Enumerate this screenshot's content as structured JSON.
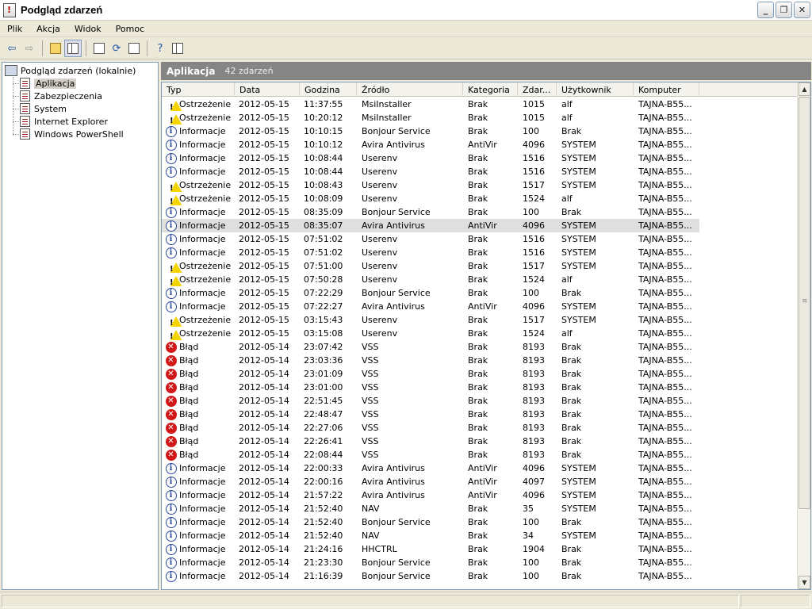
{
  "window": {
    "title": "Podgląd zdarzeń"
  },
  "menubar": [
    "Plik",
    "Akcja",
    "Widok",
    "Pomoc"
  ],
  "tree": {
    "root": "Podgląd zdarzeń (lokalnie)",
    "items": [
      {
        "label": "Aplikacja",
        "selected": true
      },
      {
        "label": "Zabezpieczenia",
        "selected": false
      },
      {
        "label": "System",
        "selected": false
      },
      {
        "label": "Internet Explorer",
        "selected": false
      },
      {
        "label": "Windows PowerShell",
        "selected": false
      }
    ]
  },
  "panel": {
    "title": "Aplikacja",
    "count": "42 zdarzeń"
  },
  "columns": [
    "Typ",
    "Data",
    "Godzina",
    "Źródło",
    "Kategoria",
    "Zdar...",
    "Użytkownik",
    "Komputer"
  ],
  "rows": [
    {
      "type": "warn",
      "t": "Ostrzeżenie",
      "d": "2012-05-15",
      "h": "11:37:55",
      "s": "MsiInstaller",
      "c": "Brak",
      "e": "1015",
      "u": "alf",
      "k": "TAJNA-B55..."
    },
    {
      "type": "warn",
      "t": "Ostrzeżenie",
      "d": "2012-05-15",
      "h": "10:20:12",
      "s": "MsiInstaller",
      "c": "Brak",
      "e": "1015",
      "u": "alf",
      "k": "TAJNA-B55..."
    },
    {
      "type": "info",
      "t": "Informacje",
      "d": "2012-05-15",
      "h": "10:10:15",
      "s": "Bonjour Service",
      "c": "Brak",
      "e": "100",
      "u": "Brak",
      "k": "TAJNA-B55..."
    },
    {
      "type": "info",
      "t": "Informacje",
      "d": "2012-05-15",
      "h": "10:10:12",
      "s": "Avira Antivirus",
      "c": "AntiVir",
      "e": "4096",
      "u": "SYSTEM",
      "k": "TAJNA-B55..."
    },
    {
      "type": "info",
      "t": "Informacje",
      "d": "2012-05-15",
      "h": "10:08:44",
      "s": "Userenv",
      "c": "Brak",
      "e": "1516",
      "u": "SYSTEM",
      "k": "TAJNA-B55..."
    },
    {
      "type": "info",
      "t": "Informacje",
      "d": "2012-05-15",
      "h": "10:08:44",
      "s": "Userenv",
      "c": "Brak",
      "e": "1516",
      "u": "SYSTEM",
      "k": "TAJNA-B55..."
    },
    {
      "type": "warn",
      "t": "Ostrzeżenie",
      "d": "2012-05-15",
      "h": "10:08:43",
      "s": "Userenv",
      "c": "Brak",
      "e": "1517",
      "u": "SYSTEM",
      "k": "TAJNA-B55..."
    },
    {
      "type": "warn",
      "t": "Ostrzeżenie",
      "d": "2012-05-15",
      "h": "10:08:09",
      "s": "Userenv",
      "c": "Brak",
      "e": "1524",
      "u": "alf",
      "k": "TAJNA-B55..."
    },
    {
      "type": "info",
      "t": "Informacje",
      "d": "2012-05-15",
      "h": "08:35:09",
      "s": "Bonjour Service",
      "c": "Brak",
      "e": "100",
      "u": "Brak",
      "k": "TAJNA-B55..."
    },
    {
      "type": "info",
      "t": "Informacje",
      "d": "2012-05-15",
      "h": "08:35:07",
      "s": "Avira Antivirus",
      "c": "AntiVir",
      "e": "4096",
      "u": "SYSTEM",
      "k": "TAJNA-B55...",
      "selected": true
    },
    {
      "type": "info",
      "t": "Informacje",
      "d": "2012-05-15",
      "h": "07:51:02",
      "s": "Userenv",
      "c": "Brak",
      "e": "1516",
      "u": "SYSTEM",
      "k": "TAJNA-B55..."
    },
    {
      "type": "info",
      "t": "Informacje",
      "d": "2012-05-15",
      "h": "07:51:02",
      "s": "Userenv",
      "c": "Brak",
      "e": "1516",
      "u": "SYSTEM",
      "k": "TAJNA-B55..."
    },
    {
      "type": "warn",
      "t": "Ostrzeżenie",
      "d": "2012-05-15",
      "h": "07:51:00",
      "s": "Userenv",
      "c": "Brak",
      "e": "1517",
      "u": "SYSTEM",
      "k": "TAJNA-B55..."
    },
    {
      "type": "warn",
      "t": "Ostrzeżenie",
      "d": "2012-05-15",
      "h": "07:50:28",
      "s": "Userenv",
      "c": "Brak",
      "e": "1524",
      "u": "alf",
      "k": "TAJNA-B55..."
    },
    {
      "type": "info",
      "t": "Informacje",
      "d": "2012-05-15",
      "h": "07:22:29",
      "s": "Bonjour Service",
      "c": "Brak",
      "e": "100",
      "u": "Brak",
      "k": "TAJNA-B55..."
    },
    {
      "type": "info",
      "t": "Informacje",
      "d": "2012-05-15",
      "h": "07:22:27",
      "s": "Avira Antivirus",
      "c": "AntiVir",
      "e": "4096",
      "u": "SYSTEM",
      "k": "TAJNA-B55..."
    },
    {
      "type": "warn",
      "t": "Ostrzeżenie",
      "d": "2012-05-15",
      "h": "03:15:43",
      "s": "Userenv",
      "c": "Brak",
      "e": "1517",
      "u": "SYSTEM",
      "k": "TAJNA-B55..."
    },
    {
      "type": "warn",
      "t": "Ostrzeżenie",
      "d": "2012-05-15",
      "h": "03:15:08",
      "s": "Userenv",
      "c": "Brak",
      "e": "1524",
      "u": "alf",
      "k": "TAJNA-B55..."
    },
    {
      "type": "err",
      "t": "Błąd",
      "d": "2012-05-14",
      "h": "23:07:42",
      "s": "VSS",
      "c": "Brak",
      "e": "8193",
      "u": "Brak",
      "k": "TAJNA-B55..."
    },
    {
      "type": "err",
      "t": "Błąd",
      "d": "2012-05-14",
      "h": "23:03:36",
      "s": "VSS",
      "c": "Brak",
      "e": "8193",
      "u": "Brak",
      "k": "TAJNA-B55..."
    },
    {
      "type": "err",
      "t": "Błąd",
      "d": "2012-05-14",
      "h": "23:01:09",
      "s": "VSS",
      "c": "Brak",
      "e": "8193",
      "u": "Brak",
      "k": "TAJNA-B55..."
    },
    {
      "type": "err",
      "t": "Błąd",
      "d": "2012-05-14",
      "h": "23:01:00",
      "s": "VSS",
      "c": "Brak",
      "e": "8193",
      "u": "Brak",
      "k": "TAJNA-B55..."
    },
    {
      "type": "err",
      "t": "Błąd",
      "d": "2012-05-14",
      "h": "22:51:45",
      "s": "VSS",
      "c": "Brak",
      "e": "8193",
      "u": "Brak",
      "k": "TAJNA-B55..."
    },
    {
      "type": "err",
      "t": "Błąd",
      "d": "2012-05-14",
      "h": "22:48:47",
      "s": "VSS",
      "c": "Brak",
      "e": "8193",
      "u": "Brak",
      "k": "TAJNA-B55..."
    },
    {
      "type": "err",
      "t": "Błąd",
      "d": "2012-05-14",
      "h": "22:27:06",
      "s": "VSS",
      "c": "Brak",
      "e": "8193",
      "u": "Brak",
      "k": "TAJNA-B55..."
    },
    {
      "type": "err",
      "t": "Błąd",
      "d": "2012-05-14",
      "h": "22:26:41",
      "s": "VSS",
      "c": "Brak",
      "e": "8193",
      "u": "Brak",
      "k": "TAJNA-B55..."
    },
    {
      "type": "err",
      "t": "Błąd",
      "d": "2012-05-14",
      "h": "22:08:44",
      "s": "VSS",
      "c": "Brak",
      "e": "8193",
      "u": "Brak",
      "k": "TAJNA-B55..."
    },
    {
      "type": "info",
      "t": "Informacje",
      "d": "2012-05-14",
      "h": "22:00:33",
      "s": "Avira Antivirus",
      "c": "AntiVir",
      "e": "4096",
      "u": "SYSTEM",
      "k": "TAJNA-B55..."
    },
    {
      "type": "info",
      "t": "Informacje",
      "d": "2012-05-14",
      "h": "22:00:16",
      "s": "Avira Antivirus",
      "c": "AntiVir",
      "e": "4097",
      "u": "SYSTEM",
      "k": "TAJNA-B55..."
    },
    {
      "type": "info",
      "t": "Informacje",
      "d": "2012-05-14",
      "h": "21:57:22",
      "s": "Avira Antivirus",
      "c": "AntiVir",
      "e": "4096",
      "u": "SYSTEM",
      "k": "TAJNA-B55..."
    },
    {
      "type": "info",
      "t": "Informacje",
      "d": "2012-05-14",
      "h": "21:52:40",
      "s": "NAV",
      "c": "Brak",
      "e": "35",
      "u": "SYSTEM",
      "k": "TAJNA-B55..."
    },
    {
      "type": "info",
      "t": "Informacje",
      "d": "2012-05-14",
      "h": "21:52:40",
      "s": "Bonjour Service",
      "c": "Brak",
      "e": "100",
      "u": "Brak",
      "k": "TAJNA-B55..."
    },
    {
      "type": "info",
      "t": "Informacje",
      "d": "2012-05-14",
      "h": "21:52:40",
      "s": "NAV",
      "c": "Brak",
      "e": "34",
      "u": "SYSTEM",
      "k": "TAJNA-B55..."
    },
    {
      "type": "info",
      "t": "Informacje",
      "d": "2012-05-14",
      "h": "21:24:16",
      "s": "HHCTRL",
      "c": "Brak",
      "e": "1904",
      "u": "Brak",
      "k": "TAJNA-B55..."
    },
    {
      "type": "info",
      "t": "Informacje",
      "d": "2012-05-14",
      "h": "21:23:30",
      "s": "Bonjour Service",
      "c": "Brak",
      "e": "100",
      "u": "Brak",
      "k": "TAJNA-B55..."
    },
    {
      "type": "info",
      "t": "Informacje",
      "d": "2012-05-14",
      "h": "21:16:39",
      "s": "Bonjour Service",
      "c": "Brak",
      "e": "100",
      "u": "Brak",
      "k": "TAJNA-B55..."
    }
  ]
}
